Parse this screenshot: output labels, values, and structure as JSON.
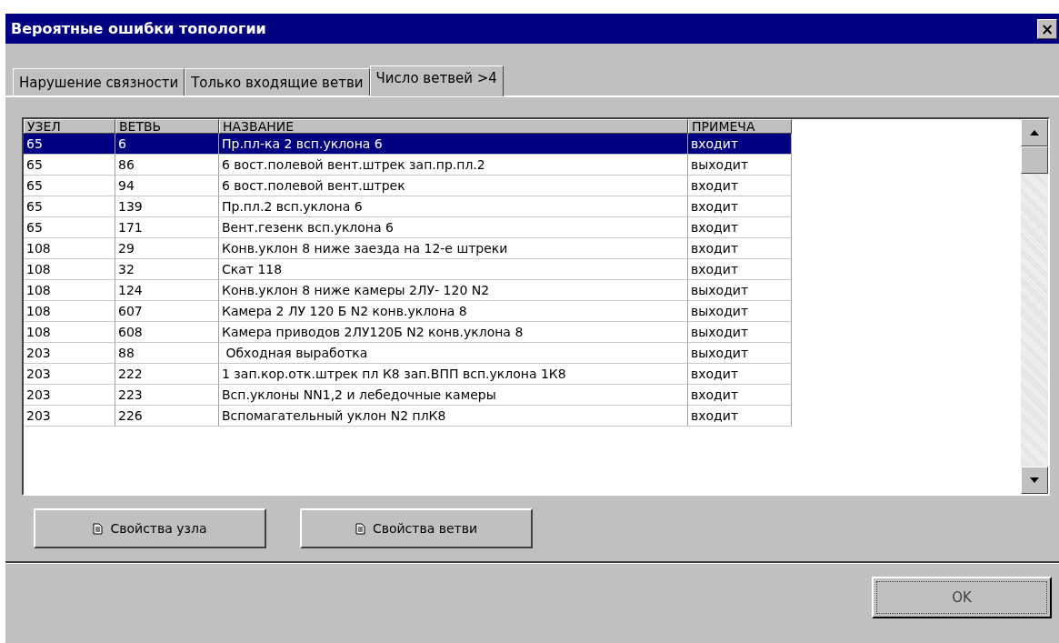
{
  "window": {
    "title": "Вероятные ошибки топологии",
    "close": "×"
  },
  "tabs": [
    {
      "label": "Нарушение связности",
      "selected": false
    },
    {
      "label": "Только входящие ветви",
      "selected": false
    },
    {
      "label": "Число ветвей >4",
      "selected": true
    }
  ],
  "table": {
    "columns": [
      "УЗЕЛ",
      "ВЕТВЬ",
      "НАЗВАНИЕ",
      "ПРИМЕЧА"
    ],
    "rows": [
      {
        "cells": [
          "65",
          "6",
          "Пр.пл-ка 2 всп.уклона 6",
          "входит"
        ],
        "selected": true
      },
      {
        "cells": [
          "65",
          "86",
          "6 вост.полевой вент.штрек зап.пр.пл.2",
          "выходит"
        ],
        "selected": false
      },
      {
        "cells": [
          "65",
          "94",
          "6 вост.полевой вент.штрек",
          "входит"
        ],
        "selected": false
      },
      {
        "cells": [
          "65",
          "139",
          "Пр.пл.2 всп.уклона 6",
          "входит"
        ],
        "selected": false
      },
      {
        "cells": [
          "65",
          "171",
          "Вент.гезенк всп.уклона 6",
          "входит"
        ],
        "selected": false
      },
      {
        "cells": [
          "108",
          "29",
          "Конв.уклон 8 ниже заезда на 12-е штреки",
          "входит"
        ],
        "selected": false
      },
      {
        "cells": [
          "108",
          "32",
          "Скат 118",
          "входит"
        ],
        "selected": false
      },
      {
        "cells": [
          "108",
          "124",
          "Конв.уклон 8 ниже камеры 2ЛУ- 120 N2",
          "выходит"
        ],
        "selected": false
      },
      {
        "cells": [
          "108",
          "607",
          "Камера 2 ЛУ 120 Б N2 конв.уклона 8",
          "выходит"
        ],
        "selected": false
      },
      {
        "cells": [
          "108",
          "608",
          "Камера приводов 2ЛУ120Б N2 конв.уклона 8",
          "выходит"
        ],
        "selected": false
      },
      {
        "cells": [
          "203",
          "88",
          " Обходная выработка",
          "выходит"
        ],
        "selected": false
      },
      {
        "cells": [
          "203",
          "222",
          "1 зап.кор.отк.штрек пл К8 зап.ВПП всп.уклона 1К8",
          "входит"
        ],
        "selected": false
      },
      {
        "cells": [
          "203",
          "223",
          "Всп.уклоны NN1,2 и лебедочные камеры",
          "входит"
        ],
        "selected": false
      },
      {
        "cells": [
          "203",
          "226",
          "Вспомагательный уклон N2 плК8",
          "входит"
        ],
        "selected": false
      }
    ]
  },
  "buttons": [
    "Свойства узла",
    "Свойства ветви"
  ],
  "ok": "OK"
}
